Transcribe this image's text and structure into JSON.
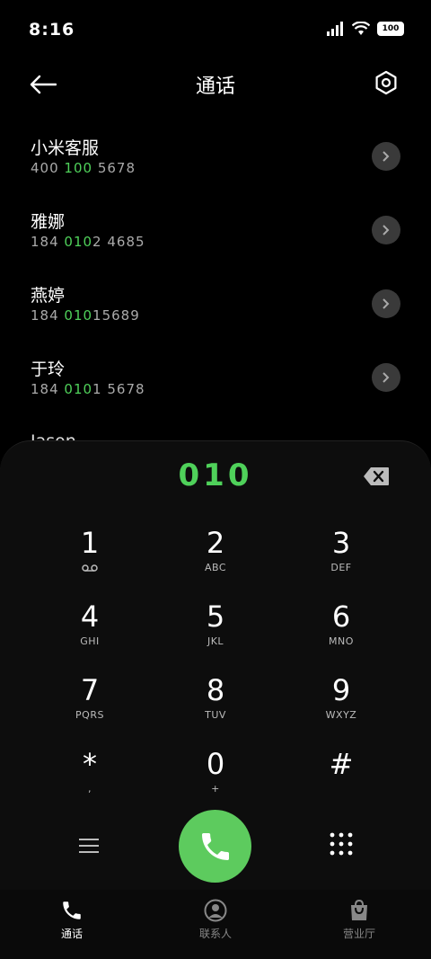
{
  "status": {
    "time": "8:16",
    "battery": "100"
  },
  "header": {
    "title": "通话"
  },
  "contacts": [
    {
      "name": "小米客服",
      "num_pre": "400 ",
      "num_hl": "100",
      "num_post": " 5678"
    },
    {
      "name": "雅娜",
      "num_pre": "184 ",
      "num_hl": "010",
      "num_post": "2 4685"
    },
    {
      "name": "燕婷",
      "num_pre": "184 ",
      "num_hl": "010",
      "num_post": "15689"
    },
    {
      "name": "于玲",
      "num_pre": "184 ",
      "num_hl": "010",
      "num_post": "1 5678"
    }
  ],
  "peek_contact": "Jason",
  "dialer": {
    "input": "010",
    "keys": [
      {
        "digit": "1",
        "sub": ""
      },
      {
        "digit": "2",
        "sub": "ABC"
      },
      {
        "digit": "3",
        "sub": "DEF"
      },
      {
        "digit": "4",
        "sub": "GHI"
      },
      {
        "digit": "5",
        "sub": "JKL"
      },
      {
        "digit": "6",
        "sub": "MNO"
      },
      {
        "digit": "7",
        "sub": "PQRS"
      },
      {
        "digit": "8",
        "sub": "TUV"
      },
      {
        "digit": "9",
        "sub": "WXYZ"
      },
      {
        "digit": "*",
        "sub": ","
      },
      {
        "digit": "0",
        "sub": "+"
      },
      {
        "digit": "#",
        "sub": ""
      }
    ]
  },
  "nav": [
    {
      "label": "通话",
      "icon": "phone-icon",
      "active": true
    },
    {
      "label": "联系人",
      "icon": "contact-icon",
      "active": false
    },
    {
      "label": "营业厅",
      "icon": "store-icon",
      "active": false
    }
  ],
  "colors": {
    "accent": "#4fd15a",
    "call": "#5dcb5e"
  }
}
